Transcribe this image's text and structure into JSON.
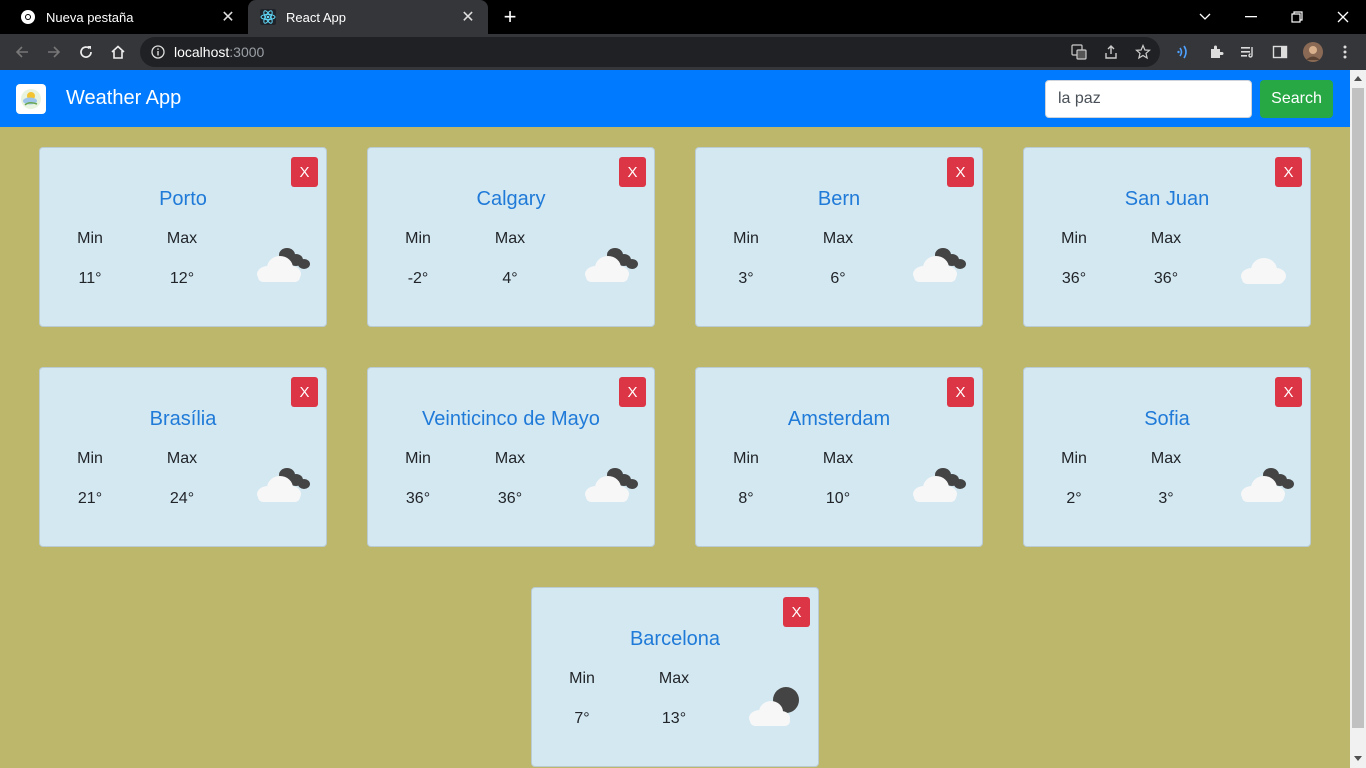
{
  "browser": {
    "tabs": [
      {
        "label": "Nueva pestaña",
        "icon": "chrome-icon",
        "active": false
      },
      {
        "label": "React App",
        "icon": "react-icon",
        "active": true
      }
    ],
    "url_host": "localhost",
    "url_port": ":3000"
  },
  "app": {
    "title": "Weather App",
    "search_value": "la paz",
    "search_label": "Search",
    "min_label": "Min",
    "max_label": "Max",
    "close_label": "X"
  },
  "cities": [
    {
      "name": "Porto",
      "min": "11°",
      "max": "12°",
      "icon": "cloudy-night-icon"
    },
    {
      "name": "Calgary",
      "min": "-2°",
      "max": "4°",
      "icon": "cloudy-night-icon"
    },
    {
      "name": "Bern",
      "min": "3°",
      "max": "6°",
      "icon": "cloudy-night-icon"
    },
    {
      "name": "San Juan",
      "min": "36°",
      "max": "36°",
      "icon": "cloud-icon"
    },
    {
      "name": "Brasília",
      "min": "21°",
      "max": "24°",
      "icon": "cloudy-night-icon"
    },
    {
      "name": "Veinticinco de Mayo",
      "min": "36°",
      "max": "36°",
      "icon": "cloudy-night-icon"
    },
    {
      "name": "Amsterdam",
      "min": "8°",
      "max": "10°",
      "icon": "cloudy-night-icon"
    },
    {
      "name": "Sofia",
      "min": "2°",
      "max": "3°",
      "icon": "cloudy-night-icon"
    },
    {
      "name": "Barcelona",
      "min": "7°",
      "max": "13°",
      "icon": "partly-cloudy-night-icon"
    }
  ],
  "colors": {
    "navbar": "#007bff",
    "background": "#bdb76b",
    "card": "#d4e8f2",
    "city_name": "#1f7ad8",
    "close_button": "#dc3545",
    "search_button": "#28a745"
  }
}
